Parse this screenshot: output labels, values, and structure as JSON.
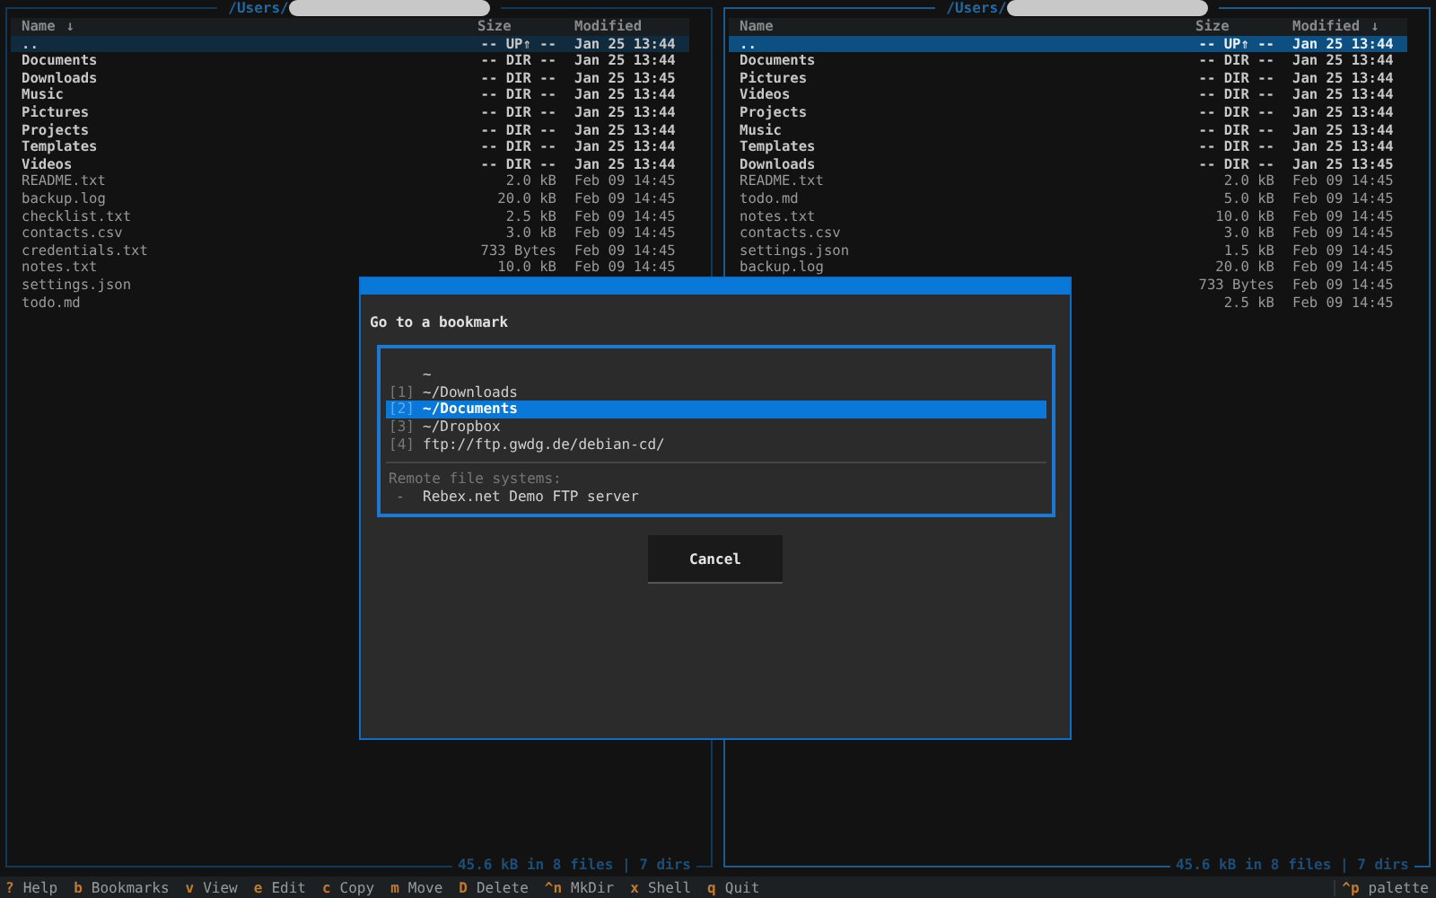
{
  "panels": [
    {
      "title": "/Users/",
      "focused": false,
      "columns": [
        {
          "label": "Name",
          "sort": "↓"
        },
        {
          "label": "Size"
        },
        {
          "label": "Modified"
        }
      ],
      "rows": [
        {
          "kind": "up",
          "name": "..",
          "size": "-- UP⇑ --",
          "modified": "Jan 25 13:44",
          "selected": true
        },
        {
          "kind": "dir",
          "name": "Documents",
          "size": "-- DIR --",
          "modified": "Jan 25 13:44",
          "selected": false
        },
        {
          "kind": "dir",
          "name": "Downloads",
          "size": "-- DIR --",
          "modified": "Jan 25 13:45",
          "selected": false
        },
        {
          "kind": "dir",
          "name": "Music",
          "size": "-- DIR --",
          "modified": "Jan 25 13:44",
          "selected": false
        },
        {
          "kind": "dir",
          "name": "Pictures",
          "size": "-- DIR --",
          "modified": "Jan 25 13:44",
          "selected": false
        },
        {
          "kind": "dir",
          "name": "Projects",
          "size": "-- DIR --",
          "modified": "Jan 25 13:44",
          "selected": false
        },
        {
          "kind": "dir",
          "name": "Templates",
          "size": "-- DIR --",
          "modified": "Jan 25 13:44",
          "selected": false
        },
        {
          "kind": "dir",
          "name": "Videos",
          "size": "-- DIR --",
          "modified": "Jan 25 13:44",
          "selected": false
        },
        {
          "kind": "file",
          "name": "README.txt",
          "size": "2.0 kB",
          "modified": "Feb 09 14:45",
          "selected": false
        },
        {
          "kind": "file",
          "name": "backup.log",
          "size": "20.0 kB",
          "modified": "Feb 09 14:45",
          "selected": false
        },
        {
          "kind": "file",
          "name": "checklist.txt",
          "size": "2.5 kB",
          "modified": "Feb 09 14:45",
          "selected": false
        },
        {
          "kind": "file",
          "name": "contacts.csv",
          "size": "3.0 kB",
          "modified": "Feb 09 14:45",
          "selected": false
        },
        {
          "kind": "file",
          "name": "credentials.txt",
          "size": "733 Bytes",
          "modified": "Feb 09 14:45",
          "selected": false
        },
        {
          "kind": "file",
          "name": "notes.txt",
          "size": "10.0 kB",
          "modified": "Feb 09 14:45",
          "selected": false
        },
        {
          "kind": "file",
          "name": "settings.json",
          "selected": false
        },
        {
          "kind": "file",
          "name": "todo.md",
          "selected": false
        }
      ],
      "status": "45.6 kB in 8 files | 7 dirs"
    },
    {
      "title": "/Users/",
      "focused": true,
      "columns": [
        {
          "label": "Name"
        },
        {
          "label": "Size"
        },
        {
          "label": "Modified",
          "sort": "↓"
        }
      ],
      "rows": [
        {
          "kind": "up",
          "name": "..",
          "size": "-- UP⇑ --",
          "modified": "Jan 25 13:44",
          "selected": true
        },
        {
          "kind": "dir",
          "name": "Documents",
          "size": "-- DIR --",
          "modified": "Jan 25 13:44",
          "selected": false
        },
        {
          "kind": "dir",
          "name": "Pictures",
          "size": "-- DIR --",
          "modified": "Jan 25 13:44",
          "selected": false
        },
        {
          "kind": "dir",
          "name": "Videos",
          "size": "-- DIR --",
          "modified": "Jan 25 13:44",
          "selected": false
        },
        {
          "kind": "dir",
          "name": "Projects",
          "size": "-- DIR --",
          "modified": "Jan 25 13:44",
          "selected": false
        },
        {
          "kind": "dir",
          "name": "Music",
          "size": "-- DIR --",
          "modified": "Jan 25 13:44",
          "selected": false
        },
        {
          "kind": "dir",
          "name": "Templates",
          "size": "-- DIR --",
          "modified": "Jan 25 13:44",
          "selected": false
        },
        {
          "kind": "dir",
          "name": "Downloads",
          "size": "-- DIR --",
          "modified": "Jan 25 13:45",
          "selected": false
        },
        {
          "kind": "file",
          "name": "README.txt",
          "size": "2.0 kB",
          "modified": "Feb 09 14:45",
          "selected": false
        },
        {
          "kind": "file",
          "name": "todo.md",
          "size": "5.0 kB",
          "modified": "Feb 09 14:45",
          "selected": false
        },
        {
          "kind": "file",
          "name": "notes.txt",
          "size": "10.0 kB",
          "modified": "Feb 09 14:45",
          "selected": false
        },
        {
          "kind": "file",
          "name": "contacts.csv",
          "size": "3.0 kB",
          "modified": "Feb 09 14:45",
          "selected": false
        },
        {
          "kind": "file",
          "name": "settings.json",
          "size": "1.5 kB",
          "modified": "Feb 09 14:45",
          "selected": false
        },
        {
          "kind": "file",
          "name": "backup.log",
          "size": "20.0 kB",
          "modified": "Feb 09 14:45",
          "selected": false
        },
        {
          "kind": "file",
          "size": "733 Bytes",
          "modified": "Feb 09 14:45",
          "selected": false
        },
        {
          "kind": "file",
          "size": "2.5 kB",
          "modified": "Feb 09 14:45",
          "selected": false
        }
      ],
      "status": "45.6 kB in 8 files | 7 dirs"
    }
  ],
  "dialog": {
    "title": "Go to a bookmark",
    "bookmarks": [
      {
        "path": "~",
        "selected": false
      },
      {
        "index": "[1]",
        "path": "~/Downloads",
        "selected": false
      },
      {
        "index": "[2]",
        "path": "~/Documents",
        "selected": true
      },
      {
        "index": "[3]",
        "path": "~/Dropbox",
        "selected": false
      },
      {
        "index": "[4]",
        "path": "ftp://ftp.gwdg.de/debian-cd/",
        "selected": false
      }
    ],
    "remote_label": "Remote file systems:",
    "remote": [
      {
        "bullet": "-",
        "name": "Rebex.net Demo FTP server"
      }
    ],
    "cancel": "Cancel"
  },
  "footer": {
    "keys": [
      {
        "key": "?",
        "label": "Help"
      },
      {
        "key": "b",
        "label": "Bookmarks"
      },
      {
        "key": "v",
        "label": "View"
      },
      {
        "key": "e",
        "label": "Edit"
      },
      {
        "key": "c",
        "label": "Copy"
      },
      {
        "key": "m",
        "label": "Move"
      },
      {
        "key": "D",
        "label": "Delete"
      },
      {
        "key": "^n",
        "label": "MkDir"
      },
      {
        "key": "x",
        "label": "Shell"
      },
      {
        "key": "q",
        "label": "Quit"
      }
    ],
    "palette": {
      "key": "^p",
      "label": "palette"
    }
  }
}
